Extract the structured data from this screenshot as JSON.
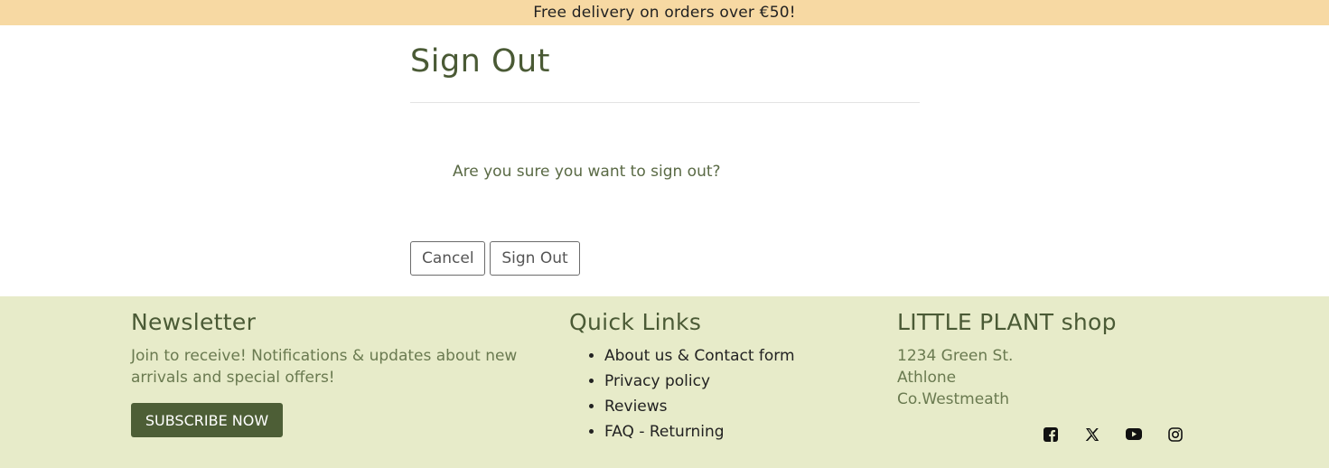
{
  "banner": {
    "text": "Free delivery on orders over €50!"
  },
  "signout": {
    "title": "Sign Out",
    "question": "Are you sure you want to sign out?",
    "cancel_label": "Cancel",
    "confirm_label": "Sign Out"
  },
  "footer": {
    "newsletter": {
      "title": "Newsletter",
      "text": "Join to receive! Notifications & updates about new arrivals and special offers!",
      "button_label": "SUBSCRIBE NOW"
    },
    "quick_links": {
      "title": "Quick Links",
      "items": [
        "About us & Contact form",
        "Privacy policy",
        "Reviews",
        "FAQ - Returning"
      ]
    },
    "shop": {
      "title": "LITTLE PLANT shop",
      "address": [
        "1234 Green St.",
        "Athlone",
        "Co.Westmeath"
      ]
    },
    "social": [
      "facebook-icon",
      "x-twitter-icon",
      "youtube-icon",
      "instagram-icon"
    ]
  },
  "colors": {
    "banner_bg": "#f7d9a3",
    "footer_bg": "#e7ebc9",
    "brand_green": "#4d5e36"
  }
}
